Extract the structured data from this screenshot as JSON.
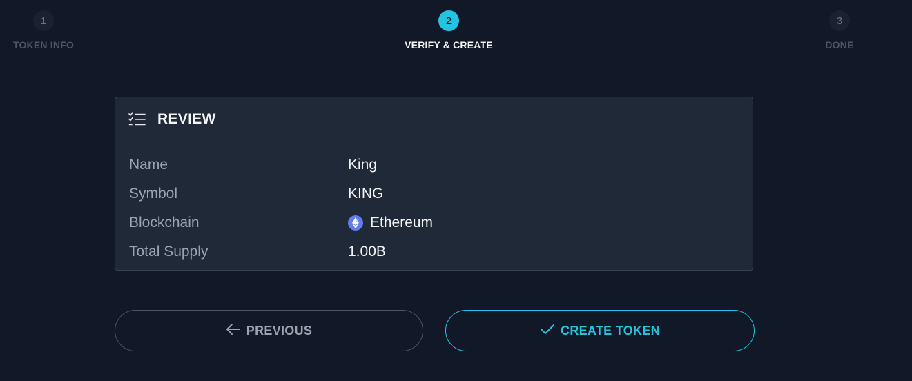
{
  "stepper": {
    "steps": [
      {
        "number": "1",
        "label": "TOKEN INFO",
        "state": "inactive"
      },
      {
        "number": "2",
        "label": "VERIFY & CREATE",
        "state": "active"
      },
      {
        "number": "3",
        "label": "DONE",
        "state": "inactive"
      }
    ]
  },
  "review": {
    "title": "REVIEW",
    "icon": "checklist-icon",
    "rows": [
      {
        "label": "Name",
        "value": "King"
      },
      {
        "label": "Symbol",
        "value": "KING"
      },
      {
        "label": "Blockchain",
        "value": "Ethereum",
        "icon": "ethereum-icon"
      },
      {
        "label": "Total Supply",
        "value": "1.00B"
      }
    ]
  },
  "actions": {
    "previous_label": "PREVIOUS",
    "previous_icon": "arrow-left-icon",
    "create_label": "CREATE TOKEN",
    "create_icon": "check-icon"
  },
  "colors": {
    "background": "#111827",
    "card": "#1f2937",
    "accent": "#22c5e0",
    "ethereum": "#627eea"
  }
}
